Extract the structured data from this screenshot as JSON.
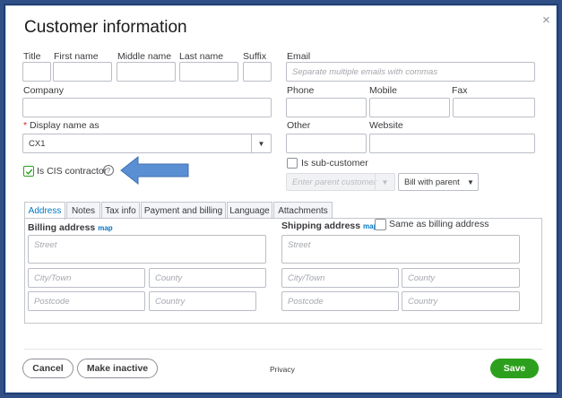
{
  "dialog": {
    "title": "Customer information",
    "close_glyph": "×"
  },
  "name": {
    "title_label": "Title",
    "first_label": "First name",
    "middle_label": "Middle name",
    "last_label": "Last name",
    "suffix_label": "Suffix"
  },
  "email": {
    "label": "Email",
    "placeholder": "Separate multiple emails with commas"
  },
  "company": {
    "label": "Company"
  },
  "display_name": {
    "required_mark": "*",
    "label": "Display name as",
    "value": "CX1"
  },
  "phone": {
    "phone_label": "Phone",
    "mobile_label": "Mobile",
    "fax_label": "Fax"
  },
  "other": {
    "other_label": "Other",
    "website_label": "Website"
  },
  "cis": {
    "label": "Is CIS contractor",
    "checked": true,
    "help_glyph": "?"
  },
  "subcustomer": {
    "label": "Is sub-customer",
    "parent_placeholder": "Enter parent customer",
    "bill_with_value": "Bill with parent"
  },
  "tabs": [
    "Address",
    "Notes",
    "Tax info",
    "Payment and billing",
    "Language",
    "Attachments"
  ],
  "billing": {
    "label": "Billing address",
    "map_link": "map",
    "street_ph": "Street",
    "city_ph": "City/Town",
    "county_ph": "County",
    "postcode_ph": "Postcode",
    "country_ph": "Country"
  },
  "shipping": {
    "label": "Shipping address",
    "map_link": "map",
    "same_as_label": "Same as billing address",
    "street_ph": "Street",
    "city_ph": "City/Town",
    "county_ph": "County",
    "postcode_ph": "Postcode",
    "country_ph": "Country"
  },
  "footer": {
    "cancel": "Cancel",
    "make_inactive": "Make inactive",
    "privacy": "Privacy",
    "save": "Save"
  },
  "colors": {
    "accent": "#0077c5",
    "save_green": "#2ca01c",
    "arrow": "#5b8fd4",
    "frame": "#2f4f86"
  }
}
